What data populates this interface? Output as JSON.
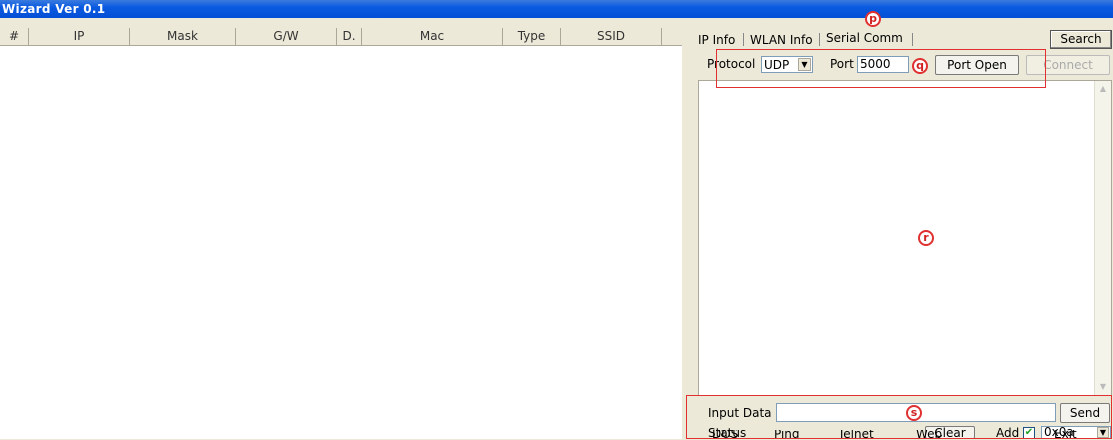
{
  "window": {
    "title": "Wizard Ver 0.1"
  },
  "device_list": {
    "columns": [
      "#",
      "IP",
      "Mask",
      "G/W",
      "D.",
      "Mac",
      "Type",
      "SSID"
    ]
  },
  "tabs": [
    "IP Info",
    "WLAN Info",
    "Serial Comm"
  ],
  "active_tab": "Serial Comm",
  "search_button": "Search",
  "protocol_row": {
    "protocol_label": "Protocol",
    "protocol_value": "UDP",
    "port_label": "Port",
    "port_value": "5000",
    "port_open_button": "Port Open",
    "connect_button": "Connect"
  },
  "input_row": {
    "input_label": "Input Data",
    "input_value": "",
    "send_button": "Send"
  },
  "status_row": {
    "status_label": "Status",
    "clear_button": "Clear",
    "add_label": "Add",
    "add_checked": true,
    "add_value": "0x0a"
  },
  "bottom_buttons": [
    "DOS",
    "Ping",
    "Telnet",
    "Web",
    "Exit"
  ],
  "annotations": {
    "p": "p",
    "q": "q",
    "r": "r",
    "s": "s"
  },
  "colors": {
    "annotation": "#e03030",
    "titlebar": "#0a5ae0"
  }
}
